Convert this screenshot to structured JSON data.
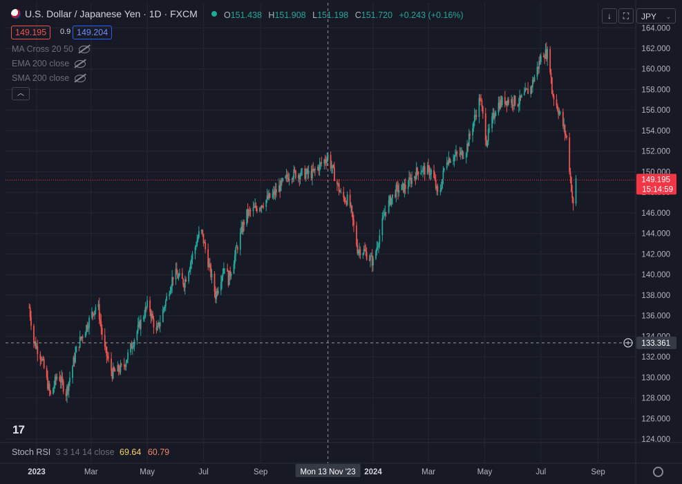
{
  "header": {
    "symbol": "U.S. Dollar / Japanese Yen · 1D · FXCM",
    "ohlc": {
      "o_key": "O",
      "o": "151.438",
      "h_key": "H",
      "h": "151.908",
      "l_key": "L",
      "l": "151.198",
      "c_key": "C",
      "c": "151.720",
      "change": "+0.243 (+0.16%)"
    },
    "sell_price": "149.195",
    "spread": "0.9",
    "buy_price": "149.204",
    "currency": "JPY"
  },
  "indicators": [
    {
      "label": "MA Cross 20 50"
    },
    {
      "label": "EMA 200 close"
    },
    {
      "label": "SMA 200 close"
    }
  ],
  "stoch": {
    "label": "Stoch RSI",
    "params": "3 3 14 14 close",
    "k": "69.64",
    "d": "60.79"
  },
  "price_axis": {
    "ticks": [
      "164.000",
      "162.000",
      "160.000",
      "158.000",
      "156.000",
      "154.000",
      "152.000",
      "150.000",
      "148.000",
      "146.000",
      "144.000",
      "142.000",
      "140.000",
      "138.000",
      "136.000",
      "134.000",
      "132.000",
      "130.000",
      "128.000",
      "126.000",
      "124.000"
    ],
    "current_price_label": "149.195",
    "countdown": "15:14:59",
    "crosshair_price": "133.361"
  },
  "time_axis": {
    "labels": [
      "2023",
      "Mar",
      "May",
      "Jul",
      "Sep",
      "2024",
      "Mar",
      "May",
      "Jul",
      "Sep"
    ],
    "crosshair_label": "Mon 13 Nov '23"
  },
  "colors": {
    "up": "#26a69a",
    "down": "#ef5350",
    "background": "#171a24",
    "grid": "#232735",
    "last_price": "#f23645"
  },
  "chart_data": {
    "type": "candlestick",
    "title": "U.S. Dollar / Japanese Yen · 1D · FXCM",
    "ylim": [
      123,
      165
    ],
    "anchors": [
      {
        "d": "2022-12-24",
        "v": 136.8
      },
      {
        "d": "2022-12-29",
        "v": 133.5
      },
      {
        "d": "2023-01-06",
        "v": 132.0
      },
      {
        "d": "2023-01-16",
        "v": 128.2
      },
      {
        "d": "2023-01-24",
        "v": 130.4
      },
      {
        "d": "2023-02-02",
        "v": 128.5
      },
      {
        "d": "2023-02-14",
        "v": 133.0
      },
      {
        "d": "2023-03-08",
        "v": 137.3
      },
      {
        "d": "2023-03-15",
        "v": 133.0
      },
      {
        "d": "2023-03-24",
        "v": 130.4
      },
      {
        "d": "2023-04-05",
        "v": 131.0
      },
      {
        "d": "2023-04-20",
        "v": 134.5
      },
      {
        "d": "2023-05-02",
        "v": 137.2
      },
      {
        "d": "2023-05-11",
        "v": 134.3
      },
      {
        "d": "2023-05-30",
        "v": 140.2
      },
      {
        "d": "2023-06-10",
        "v": 139.2
      },
      {
        "d": "2023-06-28",
        "v": 144.5
      },
      {
        "d": "2023-07-14",
        "v": 138.0
      },
      {
        "d": "2023-07-24",
        "v": 141.0
      },
      {
        "d": "2023-07-28",
        "v": 139.5
      },
      {
        "d": "2023-08-16",
        "v": 145.8
      },
      {
        "d": "2023-08-26",
        "v": 146.4
      },
      {
        "d": "2023-09-15",
        "v": 147.8
      },
      {
        "d": "2023-10-03",
        "v": 149.8
      },
      {
        "d": "2023-10-20",
        "v": 149.8
      },
      {
        "d": "2023-10-27",
        "v": 149.8
      },
      {
        "d": "2023-11-13",
        "v": 151.5
      },
      {
        "d": "2023-11-28",
        "v": 147.5
      },
      {
        "d": "2023-12-06",
        "v": 147.2
      },
      {
        "d": "2023-12-15",
        "v": 142.5
      },
      {
        "d": "2023-12-22",
        "v": 142.3
      },
      {
        "d": "2024-01-01",
        "v": 141.2
      },
      {
        "d": "2024-01-15",
        "v": 146.5
      },
      {
        "d": "2024-01-26",
        "v": 148.2
      },
      {
        "d": "2024-02-05",
        "v": 148.5
      },
      {
        "d": "2024-02-20",
        "v": 150.3
      },
      {
        "d": "2024-03-05",
        "v": 150.0
      },
      {
        "d": "2024-03-12",
        "v": 147.4
      },
      {
        "d": "2024-03-20",
        "v": 151.2
      },
      {
        "d": "2024-04-10",
        "v": 151.9
      },
      {
        "d": "2024-04-26",
        "v": 157.2
      },
      {
        "d": "2024-05-03",
        "v": 153.0
      },
      {
        "d": "2024-05-14",
        "v": 156.5
      },
      {
        "d": "2024-05-24",
        "v": 157.0
      },
      {
        "d": "2024-06-07",
        "v": 156.8
      },
      {
        "d": "2024-06-20",
        "v": 158.2
      },
      {
        "d": "2024-07-03",
        "v": 161.6
      },
      {
        "d": "2024-07-10",
        "v": 161.4
      },
      {
        "d": "2024-07-13",
        "v": 157.8
      },
      {
        "d": "2024-07-22",
        "v": 155.5
      },
      {
        "d": "2024-07-29",
        "v": 153.2
      },
      {
        "d": "2024-08-05",
        "v": 146.6
      },
      {
        "d": "2024-08-08",
        "v": 149.2
      }
    ],
    "last": {
      "value": 149.195
    }
  }
}
